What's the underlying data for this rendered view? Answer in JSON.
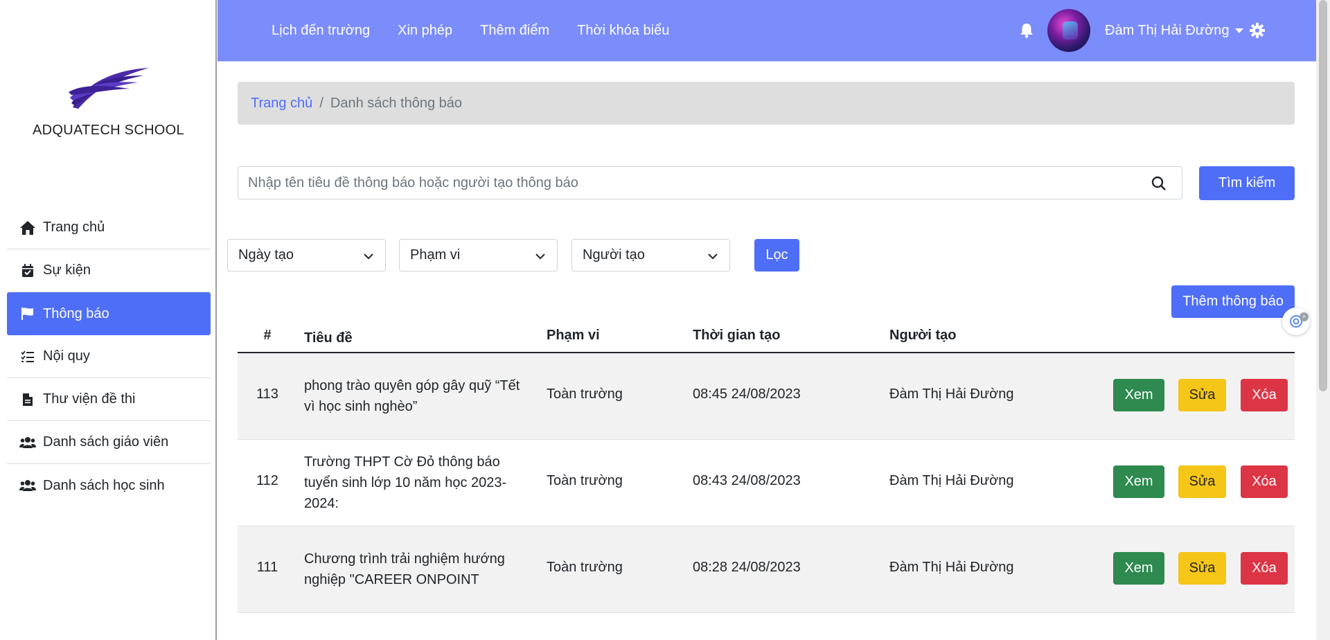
{
  "sidebar": {
    "school_name": "ADQUATECH SCHOOL",
    "items": [
      {
        "label": "Trang chủ",
        "icon": "home-icon",
        "active": false
      },
      {
        "label": "Sự kiện",
        "icon": "calendar-check-icon",
        "active": false
      },
      {
        "label": "Thông báo",
        "icon": "flag-icon",
        "active": true
      },
      {
        "label": "Nội quy",
        "icon": "checklist-icon",
        "active": false
      },
      {
        "label": "Thư viện đề thi",
        "icon": "file-icon",
        "active": false
      },
      {
        "label": "Danh sách giáo viên",
        "icon": "users-icon",
        "active": false
      },
      {
        "label": "Danh sách học sinh",
        "icon": "users-icon",
        "active": false
      }
    ]
  },
  "header": {
    "nav": [
      "Lịch đến trường",
      "Xin phép",
      "Thêm điểm",
      "Thời khóa biểu"
    ],
    "user_name": "Đàm Thị Hải Đường",
    "bg_color": "#7b8cfb"
  },
  "breadcrumb": {
    "home": "Trang chủ",
    "separator": "/",
    "current": "Danh sách thông báo"
  },
  "search": {
    "placeholder": "Nhập tên tiêu đề thông báo hoặc người tạo thông báo",
    "button_label": "Tìm kiếm"
  },
  "filters": {
    "date": "Ngày tạo",
    "scope": "Phạm vi",
    "author": "Người tạo",
    "button_label": "Lọc"
  },
  "add_button_label": "Thêm thông báo",
  "table": {
    "headers": [
      "#",
      "Tiêu đề",
      "Phạm vi",
      "Thời gian tạo",
      "Người tạo"
    ],
    "actions": {
      "view": "Xem",
      "edit": "Sửa",
      "delete": "Xóa"
    },
    "rows": [
      {
        "id": "113",
        "title": "phong trào quyên góp gây quỹ “Tết vì học sinh nghèo”",
        "scope": "Toàn trường",
        "time": "08:45 24/08/2023",
        "author": "Đàm Thị Hải Đường"
      },
      {
        "id": "112",
        "title": "Trường THPT Cờ Đỏ thông báo tuyển sinh lớp 10 năm học 2023-2024:",
        "scope": "Toàn trường",
        "time": "08:43 24/08/2023",
        "author": "Đàm Thị Hải Đường"
      },
      {
        "id": "111",
        "title": "Chương trình trải nghiệm hướng nghiệp \"CAREER ONPOINT",
        "scope": "Toàn trường",
        "time": "08:28 24/08/2023",
        "author": "Đàm Thị Hải Đường"
      }
    ]
  },
  "colors": {
    "primary": "#4f6ef7",
    "success": "#2e8a4f",
    "warning": "#f5c518",
    "danger": "#dc3545"
  }
}
